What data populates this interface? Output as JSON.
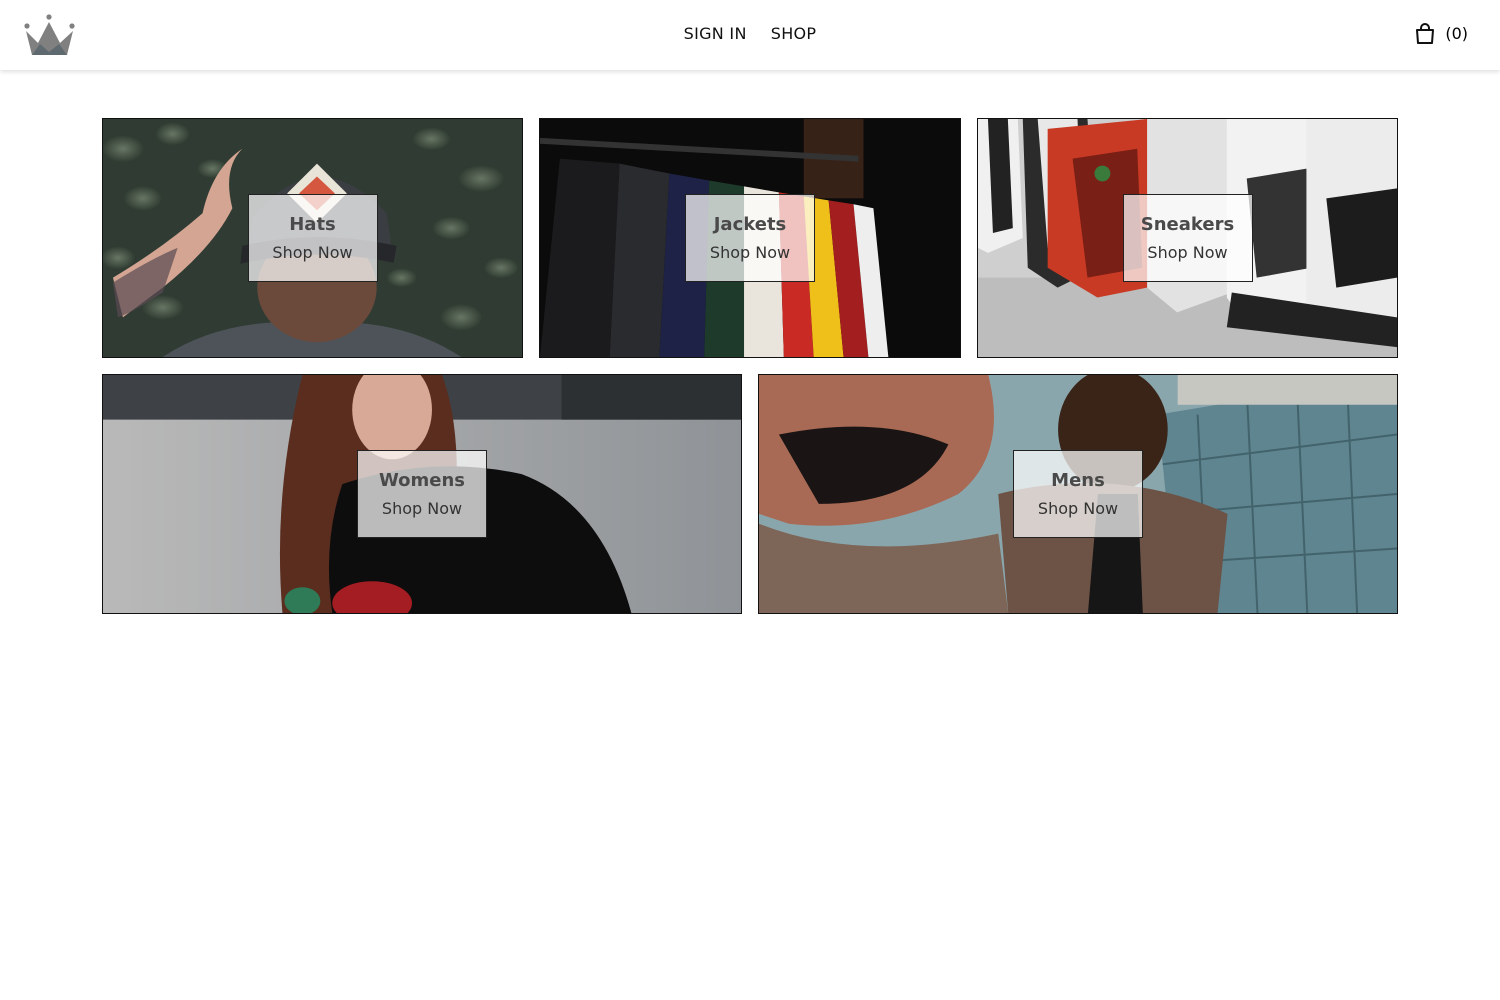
{
  "header": {
    "nav": [
      {
        "label": "SIGN IN"
      },
      {
        "label": "SHOP"
      }
    ],
    "cart_count": "(0)",
    "logo_icon": "crown-icon",
    "cart_icon": "shopping-bag-icon"
  },
  "categories": [
    {
      "title": "Hats",
      "cta": "Shop Now"
    },
    {
      "title": "Jackets",
      "cta": "Shop Now"
    },
    {
      "title": "Sneakers",
      "cta": "Shop Now"
    },
    {
      "title": "Womens",
      "cta": "Shop Now"
    },
    {
      "title": "Mens",
      "cta": "Shop Now"
    }
  ]
}
